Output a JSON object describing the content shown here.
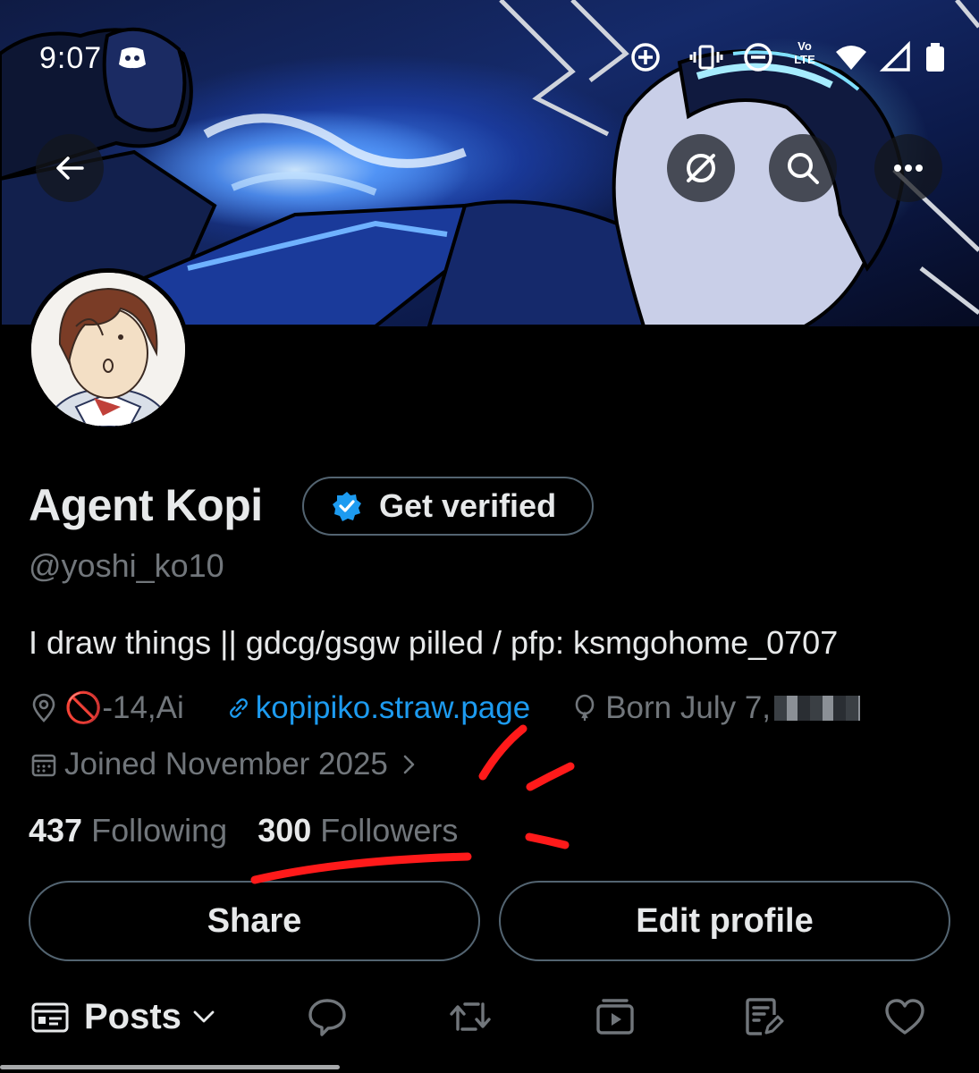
{
  "status_bar": {
    "time": "9:07",
    "icons": [
      "discord-icon",
      "data-saver-icon",
      "vibrate-icon",
      "dnd-icon",
      "volte-icon",
      "wifi-icon",
      "signal-icon",
      "battery-icon"
    ],
    "volte_top": "Vo",
    "volte_bottom": "LTE"
  },
  "header": {
    "back_icon": "arrow-left-icon",
    "action_icons": [
      "grok-icon",
      "search-icon",
      "more-icon"
    ]
  },
  "profile": {
    "display_name": "Agent Kopi",
    "verify_label": "Get verified",
    "handle": "@yoshi_ko10",
    "bio": "I draw things  || gdcg/gsgw pilled / pfp: ksmgohome_0707",
    "location_prefix": "🚫",
    "location": "-14,Ai",
    "website": "kopipiko.straw.page",
    "birthday": "Born July 7,",
    "joined": "Joined November 2025",
    "following_count": "437",
    "following_label": "Following",
    "followers_count": "300",
    "followers_label": "Followers"
  },
  "actions": {
    "share_label": "Share",
    "edit_label": "Edit profile"
  },
  "tabs": {
    "posts_label": "Posts",
    "icons": [
      "posts-icon",
      "replies-icon",
      "reposts-icon",
      "media-icon",
      "articles-icon",
      "likes-icon"
    ]
  },
  "colors": {
    "background": "#000000",
    "text_primary": "#e7e9ea",
    "text_secondary": "#71767b",
    "link": "#1d9bf0",
    "border": "#536471",
    "annotation": "#ff1a1a"
  }
}
